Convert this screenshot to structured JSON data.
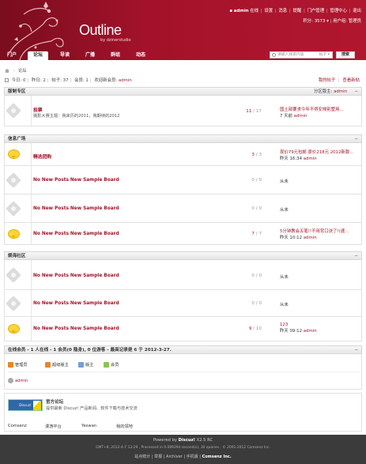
{
  "header": {
    "logo_title": "Outline",
    "logo_sub": "by dzinerstudio",
    "user_name": "admin",
    "user_status": "在线",
    "links": [
      "设置",
      "消息",
      "提醒",
      "门户管理",
      "管理中心",
      "退出"
    ],
    "credits_label": "积分: 3573",
    "group_label": "用户组: 管理员"
  },
  "nav": {
    "items": [
      "门户",
      "论坛",
      "导读",
      "广播",
      "群组",
      "动态"
    ],
    "active": "论坛",
    "search_placeholder": "请输入搜索内容",
    "search_scope": "帖子",
    "search_button": "搜索"
  },
  "breadcrumb": {
    "current": "论坛"
  },
  "stats": {
    "today_label": "今日:",
    "today": "0",
    "yesterday_label": "昨日:",
    "yesterday": "2",
    "posts_label": "帖子:",
    "posts": "37",
    "members_label": "会员:",
    "members": "1",
    "welcome_label": "欢迎新会员:",
    "newest": "admin"
  },
  "right_links": {
    "my_posts": "我的帖子",
    "latest_reply": "查看新帖"
  },
  "sections": [
    {
      "name": "版制专区",
      "moderator_label": "分区版主:",
      "moderator": "admin",
      "forums": [
        {
          "icon": "star",
          "name": "投票",
          "desc": "摄影大赛主题：我来历的2011，我期待的2012",
          "threads": "11",
          "posts": "17",
          "last_title": "国土部要求今年不得安排别墅用...",
          "last_time": "7 天前",
          "last_user": "admin"
        }
      ]
    },
    {
      "name": "信息广场",
      "moderator_label": "",
      "moderator": "",
      "forums": [
        {
          "icon": "bubble",
          "name": "精选团购",
          "desc": "",
          "threads": "3",
          "posts": "3",
          "last_title": "现价79元包邮 原价218元 2012新款...",
          "last_time": "昨天 16:34",
          "last_user": "admin"
        },
        {
          "icon": "star",
          "name": "No New Posts New Sample Board",
          "desc": "",
          "threads": "0",
          "posts": "0",
          "last_title": "",
          "last_time": "从未",
          "last_user": ""
        },
        {
          "icon": "star",
          "name": "No New Posts New Sample Board",
          "desc": "",
          "threads": "0",
          "posts": "0",
          "last_title": "",
          "last_time": "从未",
          "last_user": ""
        },
        {
          "icon": "bubble",
          "name": "No New Posts New Sample Board",
          "desc": "",
          "threads": "7",
          "posts": "7",
          "last_title": "5分钟教会五笔!!不用背口诀了!(速...",
          "last_time": "昨天 10:12",
          "last_user": "admin"
        }
      ]
    },
    {
      "name": "娱海社区",
      "moderator_label": "",
      "moderator": "",
      "forums": [
        {
          "icon": "star",
          "name": "No New Posts New Sample Board",
          "desc": "",
          "threads": "0",
          "posts": "0",
          "last_title": "",
          "last_time": "从未",
          "last_user": ""
        },
        {
          "icon": "star",
          "name": "No New Posts New Sample Board",
          "desc": "",
          "threads": "0",
          "posts": "0",
          "last_title": "",
          "last_time": "从未",
          "last_user": ""
        },
        {
          "icon": "bubble",
          "name": "No New Posts New Sample Board",
          "desc": "",
          "threads": "9",
          "posts": "10",
          "last_title": "123",
          "last_time": "昨天 09:12",
          "last_user": "admin"
        }
      ]
    }
  ],
  "online": {
    "header": "在线会员 - 1 人在线 - 1 会员(0 隐身), 0 位游客 - 最高记录是 6 于 2012-3-27.",
    "legend": [
      {
        "label": "管理员",
        "color": "#e8862a"
      },
      {
        "label": "超级版主",
        "color": "#e8862a"
      },
      {
        "label": "版主",
        "color": "#6fa0d8"
      },
      {
        "label": "会员",
        "color": "#8cc24e"
      }
    ],
    "user": "admin"
  },
  "friend_links": {
    "logo_text": "Discuz!",
    "title": "官方论坛",
    "desc": "提供最新 Discuz! 产品新闻、软件下载与技术交流",
    "text_links": [
      "Comsenz",
      "漫游平台",
      "Yeswan",
      "我的领地"
    ]
  },
  "footer": {
    "powered_prefix": "Powered by",
    "product": "Discuz!",
    "version": "X2.5 RC",
    "line2": "GMT+8, 2012-4-7 13:29 , Processed in 0.089294 second(s), 30 queries .  © 2001-2012 Comsenz Inc.",
    "links": [
      "站点统计",
      "举报",
      "Archiver",
      "手机版"
    ],
    "company": "Comsenz Inc."
  },
  "colors": {
    "brand": "#a11428",
    "header_dark": "#7a0d1e",
    "footer": "#3b3b3b"
  }
}
